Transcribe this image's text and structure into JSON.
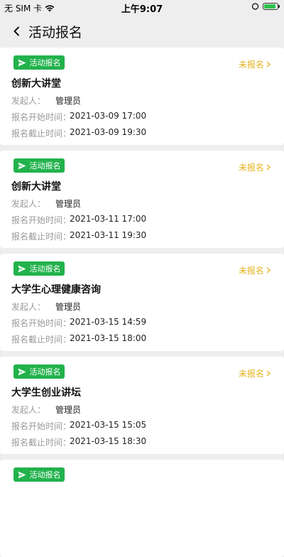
{
  "status_bar": {
    "carrier": "无 SIM 卡",
    "time": "上午9:07",
    "icons": [
      "wifi-icon",
      "battery-icon"
    ],
    "battery_color": "#2ec24a"
  },
  "nav": {
    "title": "活动报名",
    "back_icon": "chevron-left-icon"
  },
  "colors": {
    "badge_green": "#22b24c",
    "status_yellow": "#e6b422",
    "label_gray": "#9a9a9a",
    "page_bg": "#eeeeee"
  },
  "labels": {
    "initiator": "发起人：",
    "start_time": "报名开始时间：",
    "deadline": "报名截止时间："
  },
  "events": [
    {
      "badge": "活动报名",
      "status": "未报名",
      "title": "创新大讲堂",
      "initiator": "管理员",
      "start_time": "2021-03-09 17:00",
      "deadline": "2021-03-09 19:30"
    },
    {
      "badge": "活动报名",
      "status": "未报名",
      "title": "创新大讲堂",
      "initiator": "管理员",
      "start_time": "2021-03-11 17:00",
      "deadline": "2021-03-11 19:30"
    },
    {
      "badge": "活动报名",
      "status": "未报名",
      "title": "大学生心理健康咨询",
      "initiator": "管理员",
      "start_time": "2021-03-15 14:59",
      "deadline": "2021-03-15 18:00"
    },
    {
      "badge": "活动报名",
      "status": "未报名",
      "title": "大学生创业讲坛",
      "initiator": "管理员",
      "start_time": "2021-03-15 15:05",
      "deadline": "2021-03-15 18:30"
    },
    {
      "badge": "活动报名",
      "status": "",
      "title": "",
      "initiator": "",
      "start_time": "",
      "deadline": ""
    }
  ]
}
